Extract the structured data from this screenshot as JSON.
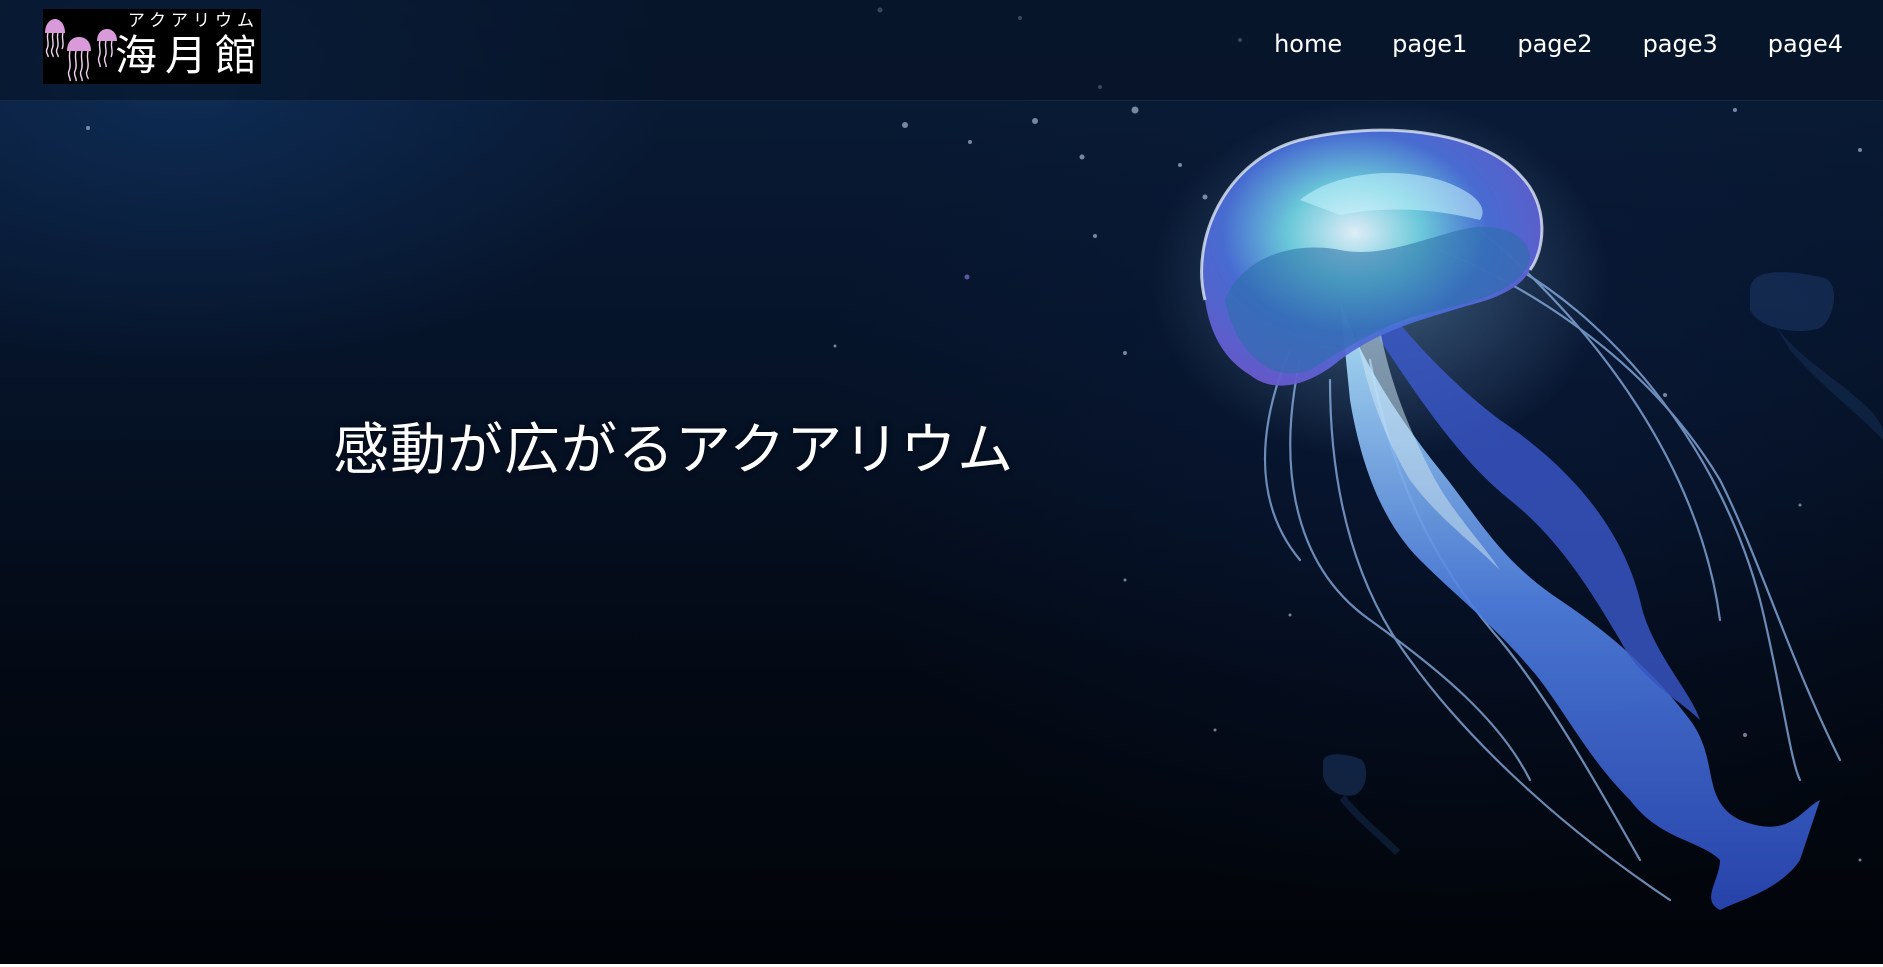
{
  "header": {
    "logo": {
      "kana": "アクアリウム",
      "name": "海月館"
    },
    "nav": [
      {
        "label": "home"
      },
      {
        "label": "page1"
      },
      {
        "label": "page2"
      },
      {
        "label": "page3"
      },
      {
        "label": "page4"
      }
    ]
  },
  "hero": {
    "title": "感動が広がるアクアリウム"
  },
  "colors": {
    "background_top": "#0a1c38",
    "background_bottom": "#010409",
    "jellyfish_bell": "#5a6fe0",
    "jellyfish_glow": "#8ae0f0",
    "logo_jellyfish": "#d89ad8",
    "text": "#ffffff"
  },
  "icons": {
    "logo_mark": "jellyfish-icon",
    "hero_image": "jellyfish-illustration"
  }
}
